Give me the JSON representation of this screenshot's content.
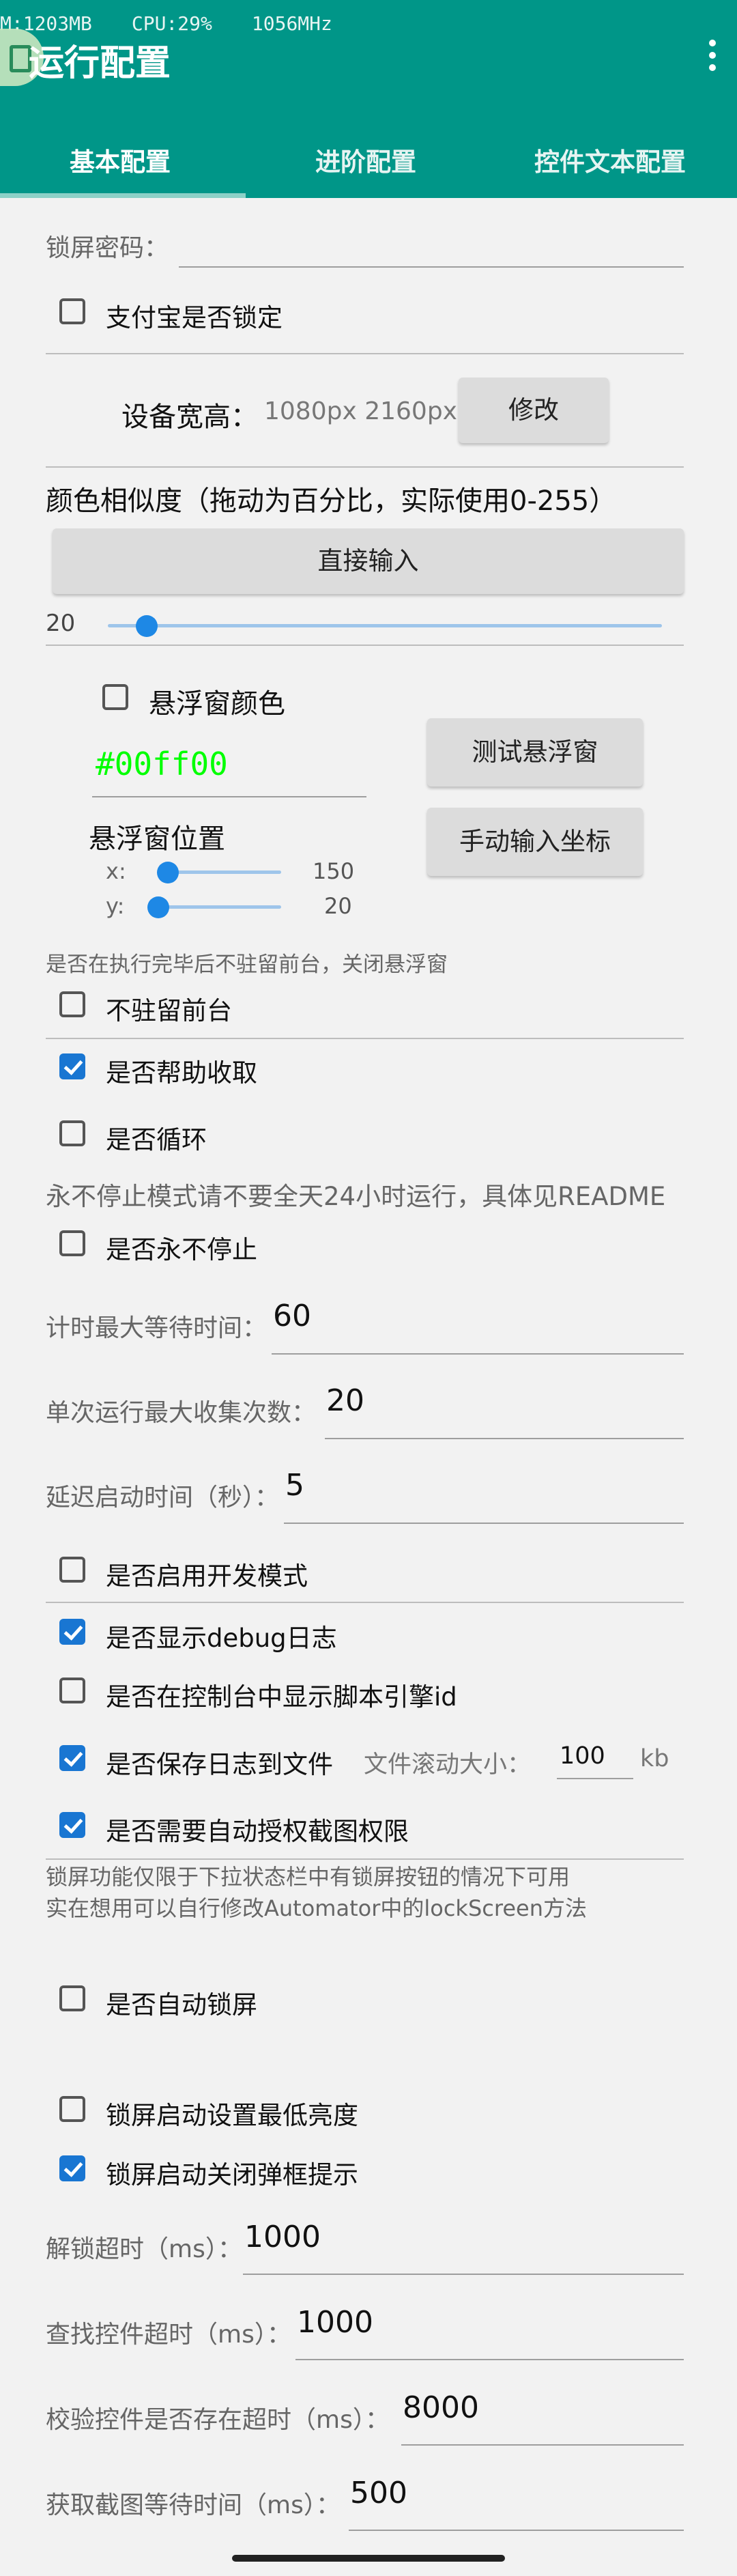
{
  "status": {
    "mem": "M:1203MB",
    "cpu": "CPU:29%",
    "freq": "1056MHz"
  },
  "title": "运行配置",
  "tabs": [
    "基本配置",
    "进阶配置",
    "控件文本配置"
  ],
  "lock_password": {
    "label": "锁屏密码：",
    "value": ""
  },
  "alipay_locked": {
    "label": "支付宝是否锁定",
    "checked": false
  },
  "device": {
    "label": "设备宽高：",
    "value": "1080px 2160px",
    "button": "修改"
  },
  "color_similarity": {
    "title": "颜色相似度（拖动为百分比，实际使用0-255）",
    "button": "直接输入",
    "value": "20",
    "percent": 0.07
  },
  "float_window": {
    "color_label": "悬浮窗颜色",
    "color_checked": false,
    "color_value": "#00ff00",
    "color_hex": "#00ff00",
    "test_button": "测试悬浮窗",
    "position_title": "悬浮窗位置",
    "x_label": "x:",
    "x_value": "150",
    "x_fraction": 0.08,
    "y_label": "y:",
    "y_value": "20",
    "y_fraction": 0.0,
    "manual_button": "手动输入坐标"
  },
  "hint_close_float": "是否在执行完毕后不驻留前台，关闭悬浮窗",
  "checks_a": [
    {
      "label": "不驻留前台",
      "checked": false
    },
    {
      "label": "是否帮助收取",
      "checked": true
    },
    {
      "label": "是否循环",
      "checked": false
    }
  ],
  "hint_never_stop": "永不停止模式请不要全天24小时运行，具体见README",
  "never_stop": {
    "label": "是否永不停止",
    "checked": false
  },
  "fields_a": [
    {
      "label": "计时最大等待时间：",
      "value": "60"
    },
    {
      "label": "单次运行最大收集次数：",
      "value": "20"
    },
    {
      "label": "延迟启动时间（秒）：",
      "value": "5"
    }
  ],
  "checks_b": [
    {
      "label": "是否启用开发模式",
      "checked": false
    },
    {
      "label": "是否显示debug日志",
      "checked": true
    },
    {
      "label": "是否在控制台中显示脚本引擎id",
      "checked": false
    },
    {
      "label": "是否保存日志到文件",
      "checked": true
    },
    {
      "label": "是否需要自动授权截图权限",
      "checked": true
    }
  ],
  "log_rolling": {
    "label": "文件滚动大小：",
    "value": "100",
    "unit": "kb"
  },
  "lock_note": [
    "锁屏功能仅限于下拉状态栏中有锁屏按钮的情况下可用",
    "实在想用可以自行修改Automator中的lockScreen方法"
  ],
  "auto_lock": {
    "label": "是否自动锁屏",
    "checked": false
  },
  "checks_c": [
    {
      "label": "锁屏启动设置最低亮度",
      "checked": false
    },
    {
      "label": "锁屏启动关闭弹框提示",
      "checked": true
    }
  ],
  "fields_b": [
    {
      "label": "解锁超时（ms）：",
      "value": "1000"
    },
    {
      "label": "查找控件超时（ms）：",
      "value": "1000"
    },
    {
      "label": "校验控件是否存在超时（ms）：",
      "value": "8000"
    },
    {
      "label": "获取截图等待时间（ms）：",
      "value": "500"
    }
  ]
}
